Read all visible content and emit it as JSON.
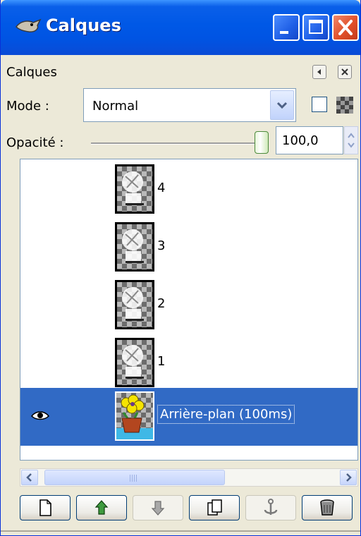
{
  "window": {
    "title": "Calques"
  },
  "dock": {
    "title": "Calques"
  },
  "mode": {
    "label": "Mode :",
    "value": "Normal"
  },
  "opacity": {
    "label": "Opacité :",
    "value": "100,0",
    "fraction": 1.0
  },
  "layers": [
    {
      "name": "4",
      "visible": false,
      "selected": false
    },
    {
      "name": "3",
      "visible": false,
      "selected": false
    },
    {
      "name": "2",
      "visible": false,
      "selected": false
    },
    {
      "name": "1",
      "visible": false,
      "selected": false
    },
    {
      "name": "Arrière-plan (100ms)",
      "visible": true,
      "selected": true
    }
  ],
  "toolbar": {
    "buttons": [
      "new-layer",
      "raise-layer",
      "lower-layer",
      "duplicate-layer",
      "anchor-layer",
      "delete-layer"
    ]
  },
  "colors": {
    "titlebar": "#0054e3",
    "selection": "#316ac5",
    "panel": "#ece9d8"
  }
}
